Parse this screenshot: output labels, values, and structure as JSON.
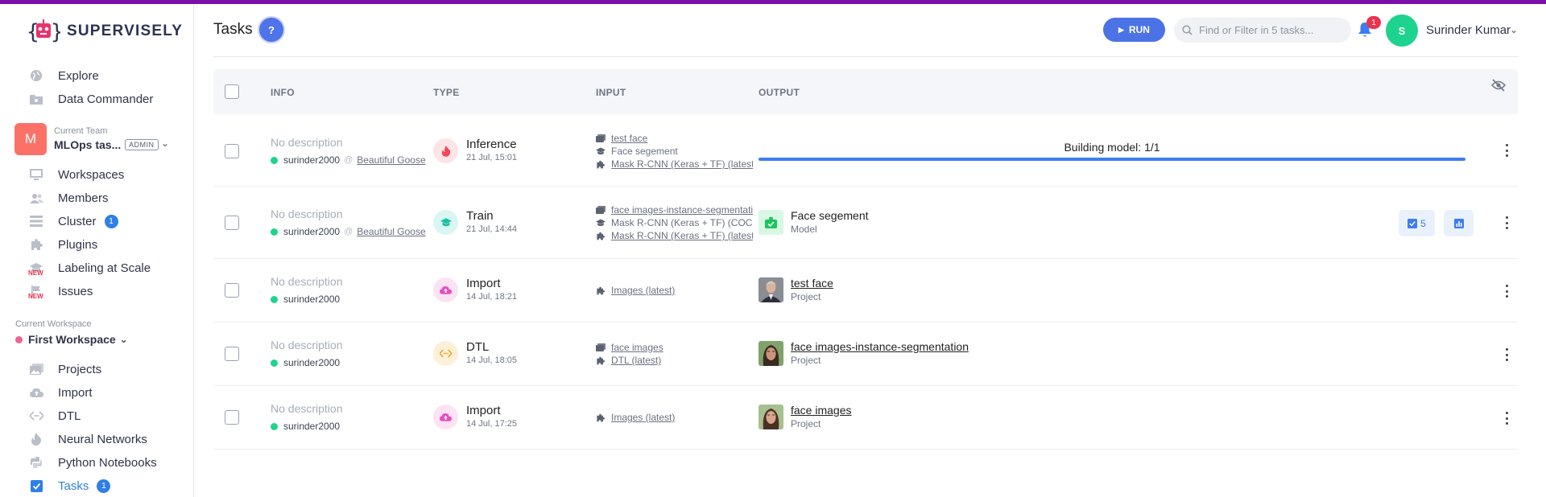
{
  "brand": {
    "name": "SUPERVISELY"
  },
  "sidebar": {
    "top_items": [
      {
        "label": "Explore",
        "icon": "globe-icon"
      },
      {
        "label": "Data Commander",
        "icon": "folder-icon"
      }
    ],
    "team": {
      "caption": "Current Team",
      "name": "MLOps tas...",
      "avatar": "M",
      "role": "ADMIN"
    },
    "team_items": [
      {
        "label": "Workspaces",
        "icon": "monitor-icon"
      },
      {
        "label": "Members",
        "icon": "users-icon"
      },
      {
        "label": "Cluster",
        "icon": "server-icon",
        "badge": "1"
      },
      {
        "label": "Plugins",
        "icon": "puzzle-icon"
      },
      {
        "label": "Labeling at Scale",
        "icon": "graduation-cap-icon",
        "tag": "NEW"
      },
      {
        "label": "Issues",
        "icon": "flag-icon",
        "tag": "NEW"
      }
    ],
    "workspace": {
      "caption": "Current Workspace",
      "name": "First Workspace"
    },
    "workspace_items": [
      {
        "label": "Projects",
        "icon": "images-icon"
      },
      {
        "label": "Import",
        "icon": "cloud-upload-icon"
      },
      {
        "label": "DTL",
        "icon": "code-icon"
      },
      {
        "label": "Neural Networks",
        "icon": "fire-icon"
      },
      {
        "label": "Python Notebooks",
        "icon": "python-icon"
      },
      {
        "label": "Tasks",
        "icon": "checkbox-icon",
        "badge": "1",
        "active": true
      }
    ]
  },
  "header": {
    "title": "Tasks",
    "help": "?",
    "run_label": "RUN",
    "search_placeholder": "Find or Filter in 5 tasks...",
    "notifications_count": "1",
    "user": {
      "name": "Surinder Kumar",
      "initial": "S"
    }
  },
  "table": {
    "columns": [
      "INFO",
      "TYPE",
      "INPUT",
      "OUTPUT"
    ],
    "rows": [
      {
        "description": "No description",
        "user": "surinder2000",
        "session": "Beautiful Goose",
        "type": "Inference",
        "date": "21 Jul, 15:01",
        "inputs": [
          {
            "icon": "images-icon",
            "text": "test face",
            "link": true
          },
          {
            "icon": "graduation-cap-icon",
            "text": "Face segement",
            "link": false
          },
          {
            "icon": "puzzle-icon",
            "text": "Mask R-CNN (Keras + TF) (latest)",
            "link": true
          }
        ],
        "output_progress": {
          "label": "Building model: 1/1",
          "fraction": 1.0
        }
      },
      {
        "description": "No description",
        "user": "surinder2000",
        "session": "Beautiful Goose",
        "type": "Train",
        "date": "21 Jul, 14:44",
        "inputs": [
          {
            "icon": "images-icon",
            "text": "face images-instance-segmentation",
            "link": true
          },
          {
            "icon": "graduation-cap-icon",
            "text": "Mask R-CNN (Keras + TF) (COCO)",
            "link": false
          },
          {
            "icon": "puzzle-icon",
            "text": "Mask R-CNN (Keras + TF) (latest)",
            "link": true
          }
        ],
        "output": {
          "name": "Face segement",
          "sub": "Model",
          "link": false,
          "checkpoints": "5"
        }
      },
      {
        "description": "No description",
        "user": "surinder2000",
        "type": "Import",
        "date": "14 Jul, 18:21",
        "inputs": [
          {
            "icon": "puzzle-icon",
            "text": "Images (latest)",
            "link": true
          }
        ],
        "output": {
          "name": "test face",
          "sub": "Project",
          "link": true
        }
      },
      {
        "description": "No description",
        "user": "surinder2000",
        "type": "DTL",
        "date": "14 Jul, 18:05",
        "inputs": [
          {
            "icon": "images-icon",
            "text": "face images",
            "link": true
          },
          {
            "icon": "puzzle-icon",
            "text": "DTL (latest)",
            "link": true
          }
        ],
        "output": {
          "name": "face images-instance-segmentation",
          "sub": "Project",
          "link": true
        }
      },
      {
        "description": "No description",
        "user": "surinder2000",
        "type": "Import",
        "date": "14 Jul, 17:25",
        "inputs": [
          {
            "icon": "puzzle-icon",
            "text": "Images (latest)",
            "link": true
          }
        ],
        "output": {
          "name": "face images",
          "sub": "Project",
          "link": true
        }
      }
    ]
  },
  "colors": {
    "accent": "#3d7df0",
    "top_bar": "#7b0fa8",
    "status_online": "#1ed38d",
    "notification": "#e8334d"
  }
}
